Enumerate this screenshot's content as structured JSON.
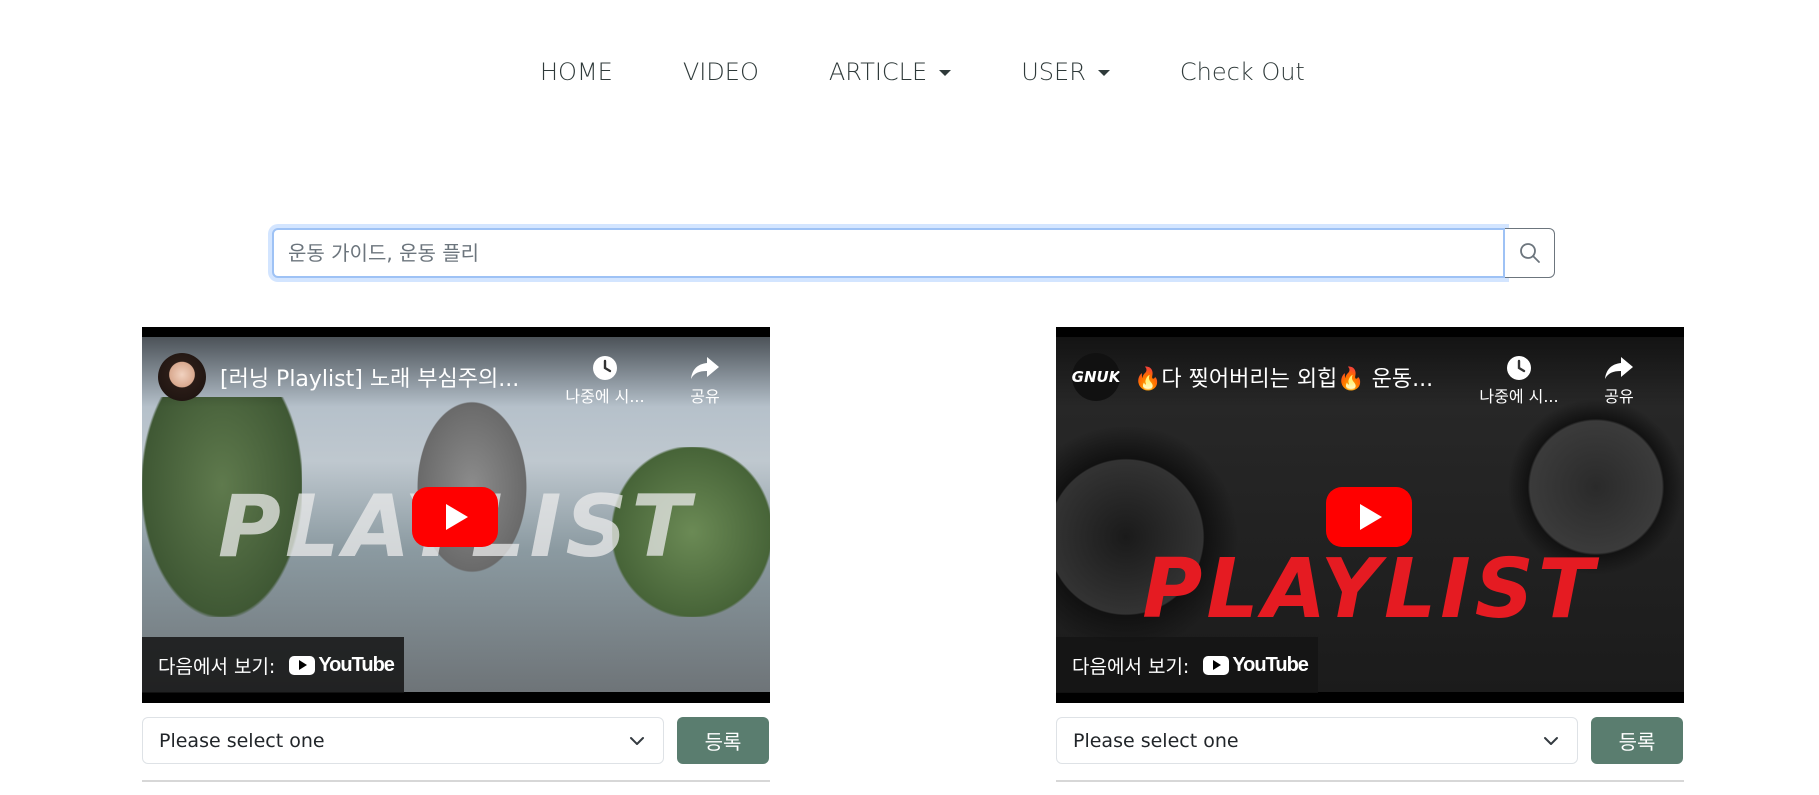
{
  "nav": {
    "items": [
      {
        "label": "HOME"
      },
      {
        "label": "VIDEO"
      },
      {
        "label": "ARTICLE"
      },
      {
        "label": "USER"
      },
      {
        "label": "Check Out"
      }
    ]
  },
  "search": {
    "placeholder": "운동 가이드, 운동 플리",
    "value": ""
  },
  "videos": [
    {
      "title": "[러닝 Playlist] 노래 부심주의...",
      "channel_avatar": "avatar-woman",
      "thumbnail_text": "PLAYLIST",
      "watch_later": "나중에 시...",
      "share": "공유",
      "watch_on": "다음에서 보기:",
      "youtube": "YouTube",
      "select_value": "Please select one",
      "register_label": "등록"
    },
    {
      "title": "🔥다 찢어버리는 외힙🔥 운동...",
      "channel_avatar": "GNUK",
      "thumbnail_text": "PLAYLIST",
      "watch_later": "나중에 시...",
      "share": "공유",
      "watch_on": "다음에서 보기:",
      "youtube": "YouTube",
      "select_value": "Please select one",
      "register_label": "등록"
    }
  ],
  "colors": {
    "accent_button": "#5a7d6f",
    "youtube_red": "#ff0000",
    "focus_border": "#9ec2f5",
    "nav_text": "#2f3a3a"
  },
  "icons": {
    "search": "search-icon",
    "clock": "clock-icon",
    "share": "share-icon",
    "play": "play-icon",
    "caret": "caret-down-icon",
    "chevron": "chevron-down-icon"
  }
}
